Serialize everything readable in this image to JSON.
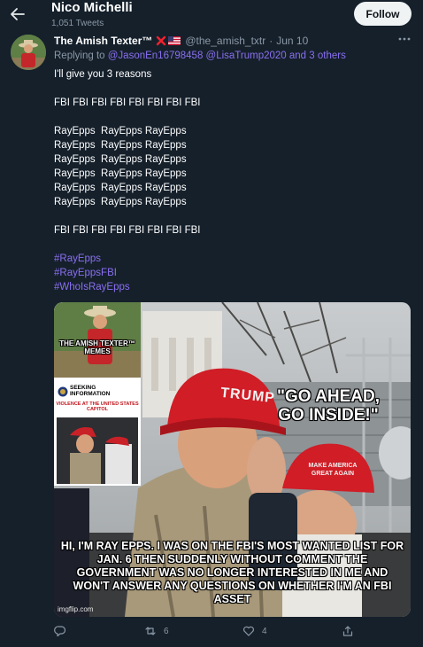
{
  "header": {
    "title": "Nico Michelli",
    "subtitle": "1,051 Tweets",
    "follow_label": "Follow"
  },
  "tweet": {
    "name": "The Amish Texter™",
    "handle": "@the_amish_txtr",
    "date": "Jun 10",
    "replying_prefix": "Replying to",
    "replying_users": "@JasonEn16798458 @LisaTrump2020 and 3 others",
    "lines": [
      "I'll give you 3 reasons",
      "",
      "FBI FBI FBI FBI FBI FBI FBI FBI",
      "",
      "RayEpps  RayEpps RayEpps",
      "RayEpps  RayEpps RayEpps",
      "RayEpps  RayEpps RayEpps",
      "RayEpps  RayEpps RayEpps",
      "RayEpps  RayEpps RayEpps",
      "RayEpps  RayEpps RayEpps",
      "",
      "FBI FBI FBI FBI FBI FBI FBI FBI",
      ""
    ],
    "hashtags": [
      "#RayEpps",
      "#RayEppsFBI",
      "#WhoIsRayEpps"
    ],
    "media": {
      "inset_meme": "THE AMISH TEXTER™ MEMES",
      "seeking_title": "SEEKING INFORMATION",
      "seeking_sub": "VIOLENCE AT THE UNITED STATES CAPITOL",
      "quote": "\"GO AHEAD, GO INSIDE!\"",
      "caption": "HI, I'M RAY EPPS. I WAS ON THE FBI'S MOST WANTED LIST FOR JAN. 6 THEN SUDDENLY WITHOUT COMMENT THE GOVERNMENT WAS NO LONGER INTERESTED IN ME AND WON'T ANSWER ANY QUESTIONS ON WHETHER I'M AN FBI ASSET",
      "hat_text_1": "TRUMP",
      "hat_text_2": "MAKE AMERICA GREAT AGAIN",
      "watermark": "imgflip.com"
    },
    "actions": {
      "reply_count": "",
      "retweet_count": "6",
      "like_count": "4"
    }
  },
  "colors": {
    "background": "#15202b",
    "link": "#8a6ff0",
    "muted": "#8b98a5",
    "flag_x": "#f4212e"
  }
}
